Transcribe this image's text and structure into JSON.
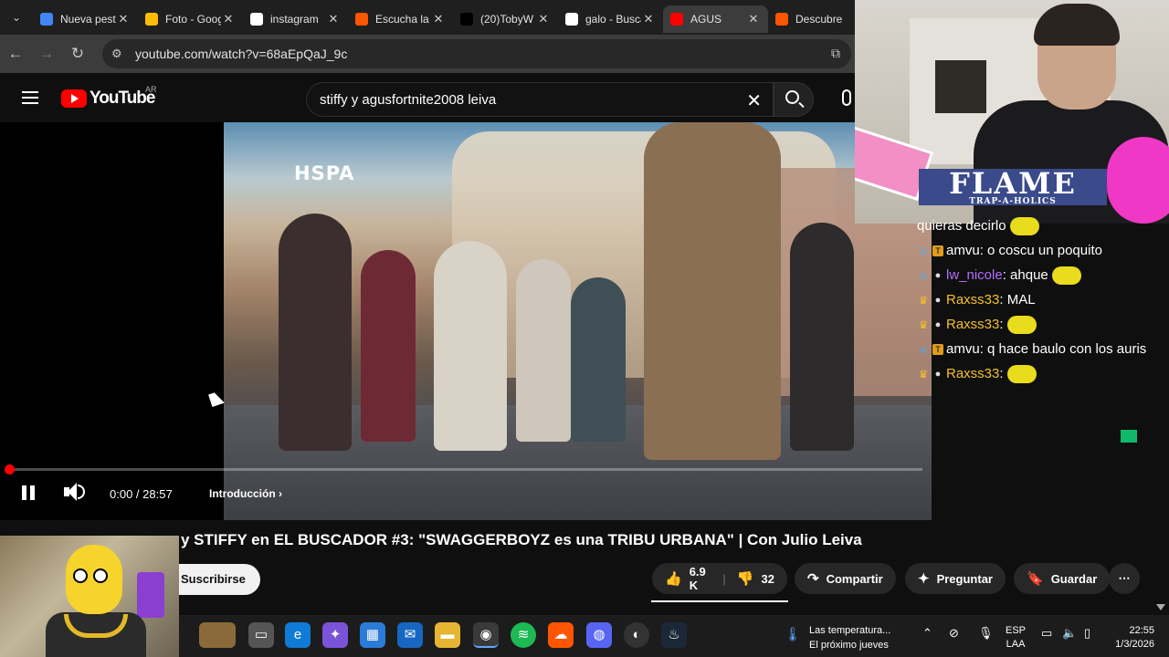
{
  "browser": {
    "tabs": [
      {
        "title": "Nueva pestaña",
        "icon": "chrome-icon",
        "color": "#4285f4",
        "active": false
      },
      {
        "title": "Foto - Google Fotos",
        "icon": "photos-icon",
        "color": "#fbbc05",
        "active": false
      },
      {
        "title": "instagram",
        "icon": "google-icon",
        "color": "#ffffff",
        "active": false
      },
      {
        "title": "Escucha la música",
        "icon": "soundcloud-icon",
        "color": "#ff5500",
        "active": false
      },
      {
        "title": "(20)TobyW",
        "icon": "tiktok-icon",
        "color": "#000000",
        "active": false
      },
      {
        "title": "galo - Buscar",
        "icon": "google-icon",
        "color": "#ffffff",
        "active": false
      },
      {
        "title": "AGUS",
        "icon": "youtube-icon",
        "color": "#ff0000",
        "active": true
      },
      {
        "title": "Descubre",
        "icon": "soundcloud-icon",
        "color": "#ff5500",
        "active": false
      }
    ],
    "url": "youtube.com/watch?v=68aEpQaJ_9c"
  },
  "youtube": {
    "logo_text": "YouTube",
    "country_code": "AR",
    "search_query": "stiffy y agusfortnite2008 leiva",
    "watermark": "HSPA",
    "player": {
      "time": "0:00 / 28:57",
      "chapter": "Introducción",
      "progress_fraction": 0.0
    },
    "video_title": "y STIFFY en EL BUSCADOR #3: \"SWAGGERBOYZ es una TRIBU URBANA\" | Con Julio Leiva",
    "subscribe_label": "Suscribirse",
    "like_count": "6.9 K",
    "dislike_count": "32",
    "share_label": "Compartir",
    "ask_label": "Preguntar",
    "save_label": "Guardar"
  },
  "stream": {
    "banner_title": "FLAME",
    "banner_sub": "TRAP-A-HOLICS",
    "chat": [
      {
        "user": "",
        "text": "quieras decirlo",
        "color": "#ffffff",
        "badges": [],
        "emote": true
      },
      {
        "user": "amvu",
        "text": ": o coscu un poquito",
        "color": "#ffffff",
        "badges": [
          "sword",
          "sub"
        ],
        "emote": false
      },
      {
        "user": "lw_nicole",
        "text": ": ahque",
        "color": "#b46eff",
        "badges": [
          "sword",
          "drop"
        ],
        "emote": true
      },
      {
        "user": "Raxss33",
        "text": ": MAL",
        "color": "#f3c12b",
        "badges": [
          "crown",
          "drop"
        ],
        "emote": false
      },
      {
        "user": "Raxss33",
        "text": ":",
        "color": "#f3c12b",
        "badges": [
          "crown",
          "drop"
        ],
        "emote": true
      },
      {
        "user": "amvu",
        "text": ": q hace baulo con los auris",
        "color": "#ffffff",
        "badges": [
          "sword",
          "sub"
        ],
        "emote": false
      },
      {
        "user": "Raxss33",
        "text": ":",
        "color": "#f3c12b",
        "badges": [
          "crown",
          "drop"
        ],
        "emote": true
      }
    ]
  },
  "taskbar": {
    "weather_title": "Las temperatura...",
    "weather_sub": "El próximo jueves",
    "lang_top": "ESP",
    "lang_bottom": "LAA",
    "time": "22:55",
    "date": "1/3/2026"
  }
}
